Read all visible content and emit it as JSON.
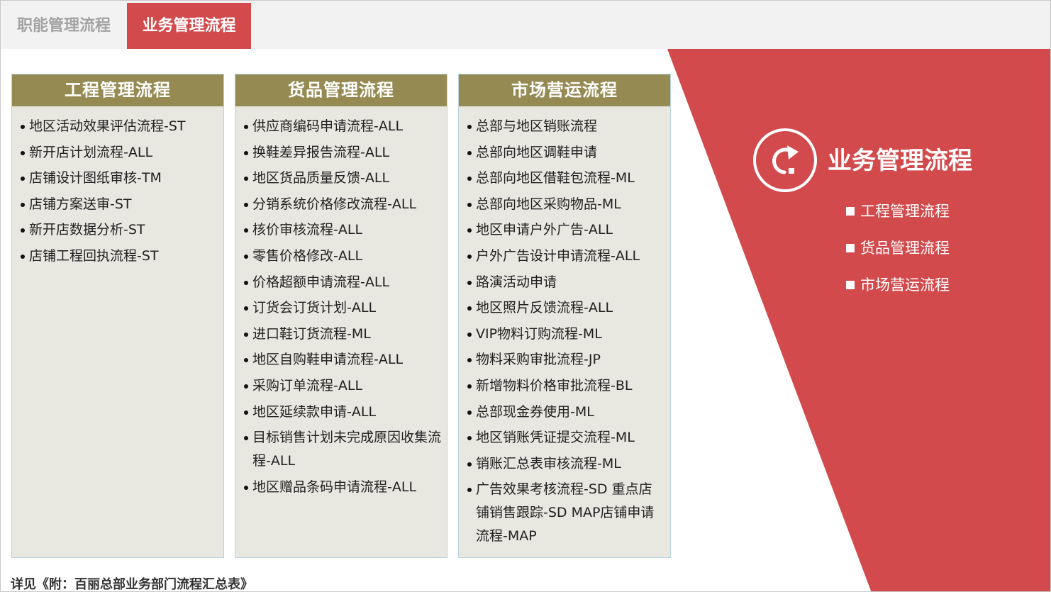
{
  "tabs": [
    {
      "label": "职能管理流程",
      "active": false
    },
    {
      "label": "业务管理流程",
      "active": true
    }
  ],
  "colors": {
    "accent": "#d24a4c",
    "column_header": "#968a53",
    "column_bg": "#e8e7e0"
  },
  "columns": [
    {
      "title": "工程管理流程",
      "items": [
        "地区活动效果评估流程-ST",
        "新开店计划流程-ALL",
        "店铺设计图纸审核-TM",
        "店铺方案送审-ST",
        "新开店数据分析-ST",
        "店铺工程回执流程-ST"
      ]
    },
    {
      "title": "货品管理流程",
      "items": [
        "供应商编码申请流程-ALL",
        "换鞋差异报告流程-ALL",
        "地区货品质量反馈-ALL",
        "分销系统价格修改流程-ALL",
        "核价审核流程-ALL",
        "零售价格修改-ALL",
        "价格超额申请流程-ALL",
        "订货会订货计划-ALL",
        "进口鞋订货流程-ML",
        "地区自购鞋申请流程-ALL",
        "采购订单流程-ALL",
        "地区延续款申请-ALL",
        "目标销售计划未完成原因收集流程-ALL",
        "地区赠品条码申请流程-ALL"
      ]
    },
    {
      "title": "市场营运流程",
      "items": [
        "总部与地区销账流程",
        "总部向地区调鞋申请",
        "总部向地区借鞋包流程-ML",
        "总部向地区采购物品-ML",
        "地区申请户外广告-ALL",
        "户外广告设计申请流程-ALL",
        "路演活动申请",
        "地区照片反馈流程-ALL",
        "VIP物料订购流程-ML",
        "物料采购审批流程-JP",
        "新增物料价格审批流程-BL",
        "总部现金券使用-ML",
        "地区销账凭证提交流程-ML",
        "销账汇总表审核流程-ML",
        "广告效果考核流程-SD 重点店铺销售跟踪-SD MAP店铺申请流程-MAP"
      ]
    }
  ],
  "summary": {
    "icon": "redirect-arrow-icon",
    "title": "业务管理流程",
    "links": [
      "工程管理流程",
      "货品管理流程",
      "市场营运流程"
    ]
  },
  "footnote": "详见《附：百丽总部业务部门流程汇总表》"
}
